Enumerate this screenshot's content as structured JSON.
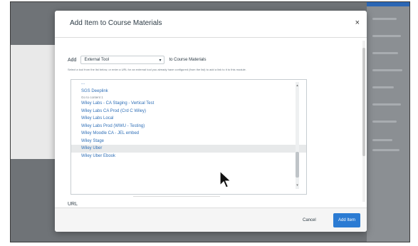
{
  "modal": {
    "title": "Add Item to Course Materials",
    "close_icon": "×"
  },
  "add_row": {
    "label": "Add",
    "selected_type": "External Tool",
    "chevron": "▾",
    "to_label": "to Course Materials"
  },
  "instructions": "Select a tool from the list below, or enter a URL for an external tool you already have configured (from the list) to add a link to it to this module.",
  "tool_list": {
    "items": [
      {
        "label": "...",
        "sub": ""
      },
      {
        "label": "SGS Deeplink",
        "sub": "Go to content 1"
      },
      {
        "label": "Wiley Labs - CA Staging - Vertical Test",
        "sub": ""
      },
      {
        "label": "Wiley Labs CA Prod (Crd C Wiley)",
        "sub": ""
      },
      {
        "label": "Wiley Labs Local",
        "sub": ""
      },
      {
        "label": "Wiley Labs Prod (WWU - Testing)",
        "sub": ""
      },
      {
        "label": "Wiley Moodle CA - JEL embed",
        "sub": ""
      },
      {
        "label": "Wiley Stage",
        "sub": ""
      },
      {
        "label": "Wiley Uber",
        "sub": ""
      },
      {
        "label": "Wiley Uber Ebook",
        "sub": ""
      }
    ],
    "selected_index": 8
  },
  "url": {
    "label": "URL",
    "value": ""
  },
  "footer": {
    "cancel_label": "Cancel",
    "add_label": "Add Item"
  },
  "colors": {
    "primary": "#2b7bd3",
    "link": "#2f6fb7",
    "overlay": "#6f7377"
  }
}
